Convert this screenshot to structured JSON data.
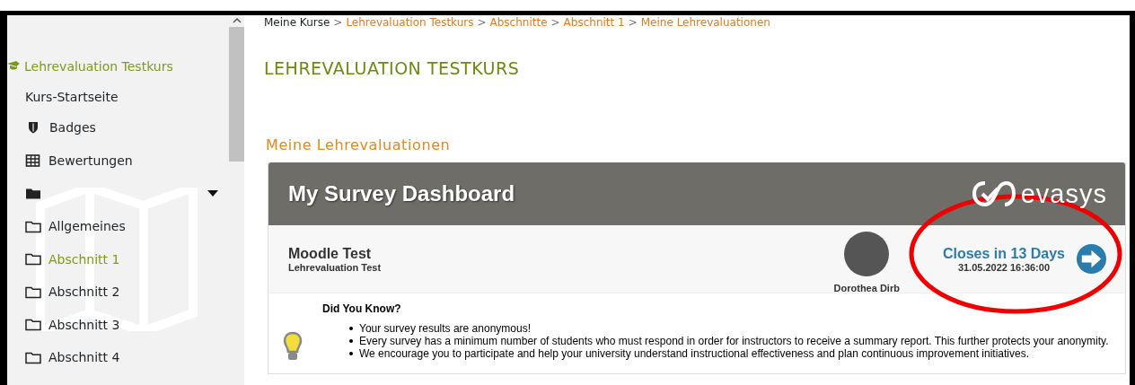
{
  "sidebar": {
    "course": {
      "label": "Lehrevaluation Testkurs",
      "selected": false
    },
    "items": [
      {
        "kind": "plain",
        "label": "Kurs-Startseite",
        "selected": false
      },
      {
        "kind": "shield",
        "label": "Badges",
        "selected": false
      },
      {
        "kind": "grid",
        "label": "Bewertungen",
        "selected": false
      },
      {
        "kind": "toggle"
      },
      {
        "kind": "folder",
        "label": "Allgemeines",
        "selected": false
      },
      {
        "kind": "folder",
        "label": "Abschnitt 1",
        "selected": true
      },
      {
        "kind": "folder",
        "label": "Abschnitt 2",
        "selected": false
      },
      {
        "kind": "folder",
        "label": "Abschnitt 3",
        "selected": false
      },
      {
        "kind": "folder",
        "label": "Abschnitt 4",
        "selected": false
      }
    ]
  },
  "breadcrumb": [
    {
      "label": "Meine Kurse",
      "link": false
    },
    {
      "label": "Lehrevaluation Testkurs",
      "link": true
    },
    {
      "label": "Abschnitte",
      "link": true
    },
    {
      "label": "Abschnitt 1",
      "link": true
    },
    {
      "label": "Meine Lehrevaluationen",
      "link": true
    }
  ],
  "breadcrumb_separator": ">",
  "heading": "LEHREVALUATION TESTKURS",
  "section_title": "Meine Lehrevaluationen",
  "dashboard": {
    "title": "My Survey Dashboard",
    "logo_text": "evasys",
    "survey": {
      "course": "Moodle Test",
      "subtitle": "Lehrevaluation Test",
      "instructor": "Dorothea Dirb",
      "closes": "Closes in 13 Days",
      "deadline": "31.05.2022 16:36:00"
    },
    "tip": {
      "title": "Did You Know?",
      "bullets": [
        "Your survey results are anonymous!",
        "Every survey has a minimum number of students who must respond in order for instructors to receive a summary report. This further protects your anonymity.",
        "We encourage you to participate and help your university understand instructional effectiveness and plan continuous improvement initiatives."
      ]
    }
  }
}
